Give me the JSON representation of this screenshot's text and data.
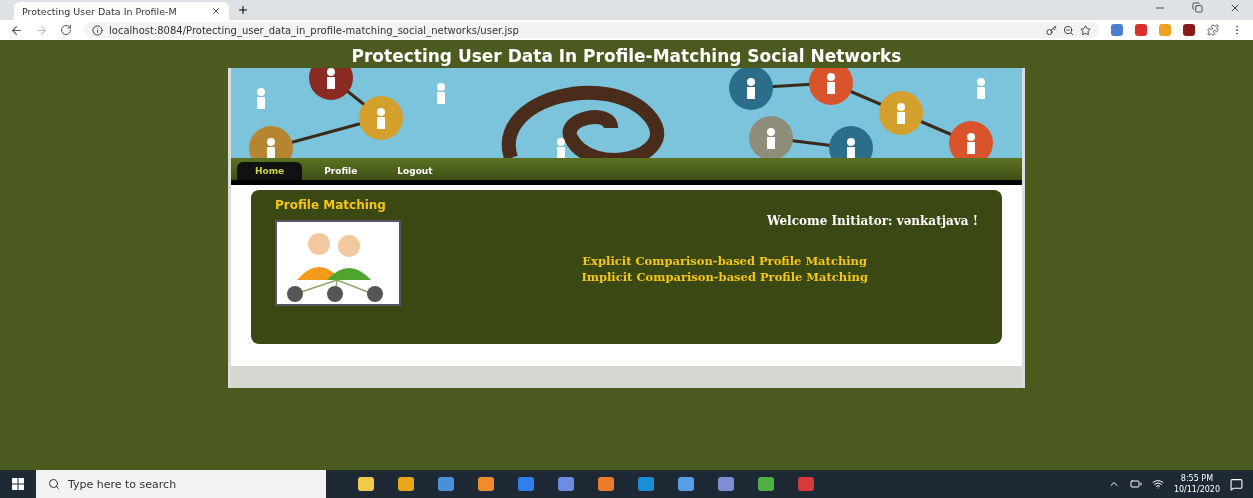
{
  "browser": {
    "tab_title": "Protecting User Data In Profile-M",
    "url": "localhost:8084/Protecting_user_data_in_profile-matching_social_networks/user.jsp"
  },
  "page": {
    "title": "Protecting User Data In Profile-Matching Social Networks",
    "nav": [
      {
        "label": "Home",
        "selected": true
      },
      {
        "label": "Profile",
        "selected": false
      },
      {
        "label": "Logout",
        "selected": false
      }
    ],
    "panel_title": "Profile Matching",
    "welcome": "Welcome Initiator:  vənkatjava !",
    "links": [
      "Explicit Comparison-based Profile Matching",
      "Implicit Comparison-based Profile Matching"
    ]
  },
  "taskbar": {
    "search_placeholder": "Type here to search",
    "time": "8:55 PM",
    "date": "10/11/2020"
  }
}
